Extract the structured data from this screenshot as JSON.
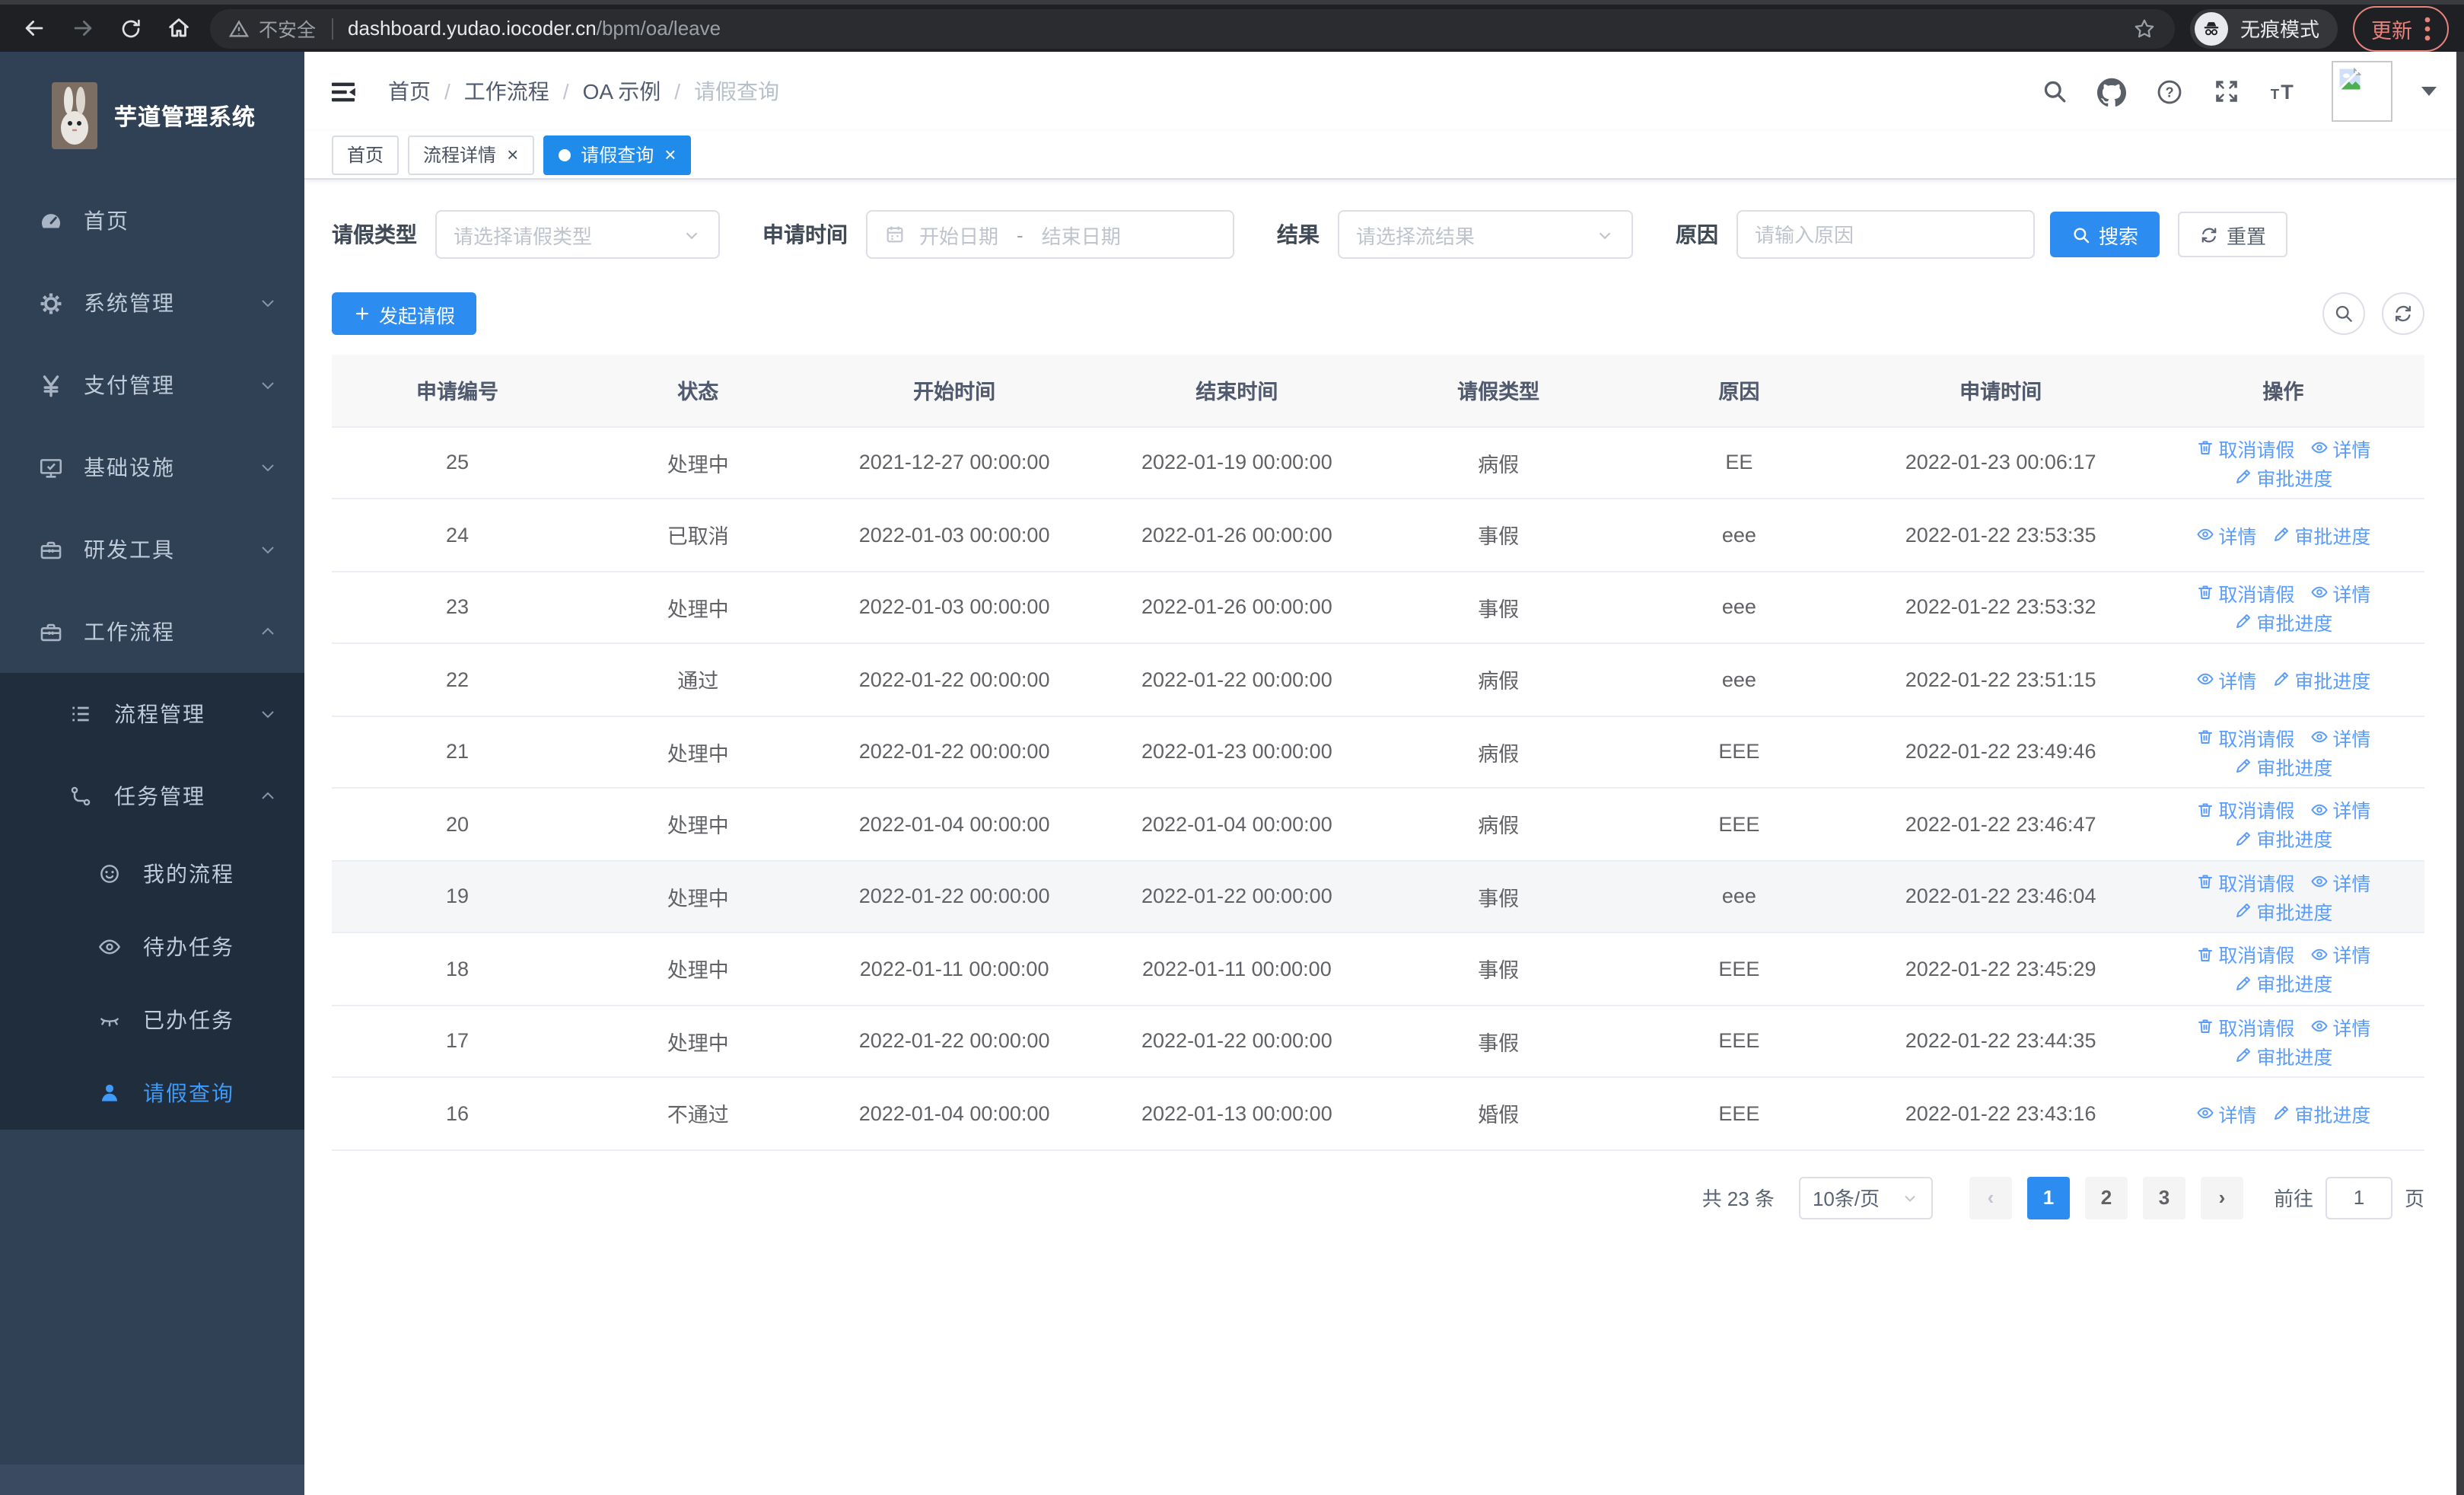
{
  "browser": {
    "security_label": "不安全",
    "url_domain": "dashboard.yudao.iocoder.cn",
    "url_path": "/bpm/oa/leave",
    "incognito_label": "无痕模式",
    "update_label": "更新"
  },
  "sidebar": {
    "app_title": "芋道管理系统",
    "menu": [
      {
        "label": "首页"
      },
      {
        "label": "系统管理"
      },
      {
        "label": "支付管理"
      },
      {
        "label": "基础设施"
      },
      {
        "label": "研发工具"
      },
      {
        "label": "工作流程"
      }
    ],
    "submenu": [
      {
        "label": "流程管理"
      },
      {
        "label": "任务管理"
      }
    ],
    "task_items": [
      {
        "label": "我的流程"
      },
      {
        "label": "待办任务"
      },
      {
        "label": "已办任务"
      },
      {
        "label": "请假查询"
      }
    ]
  },
  "header": {
    "breadcrumb": [
      "首页",
      "工作流程",
      "OA 示例",
      "请假查询"
    ]
  },
  "tabs": [
    {
      "label": "首页"
    },
    {
      "label": "流程详情"
    },
    {
      "label": "请假查询"
    }
  ],
  "filters": {
    "leave_type_label": "请假类型",
    "leave_type_placeholder": "请选择请假类型",
    "apply_time_label": "申请时间",
    "start_date_placeholder": "开始日期",
    "range_separator": "-",
    "end_date_placeholder": "结束日期",
    "result_label": "结果",
    "result_placeholder": "请选择流结果",
    "reason_label": "原因",
    "reason_placeholder": "请输入原因",
    "search_label": "搜索",
    "reset_label": "重置"
  },
  "toolbar": {
    "create_label": "发起请假"
  },
  "table": {
    "columns": [
      "申请编号",
      "状态",
      "开始时间",
      "结束时间",
      "请假类型",
      "原因",
      "申请时间",
      "操作"
    ],
    "action_defs": {
      "cancel": {
        "label": "取消请假",
        "icon": "trash"
      },
      "detail": {
        "label": "详情",
        "icon": "eye"
      },
      "progress": {
        "label": "审批进度",
        "icon": "pen"
      }
    },
    "rows": [
      {
        "id": "25",
        "status": "处理中",
        "start_time": "2021-12-27 00:00:00",
        "end_time": "2022-01-19 00:00:00",
        "leave_type": "病假",
        "reason": "EE",
        "apply_time": "2022-01-23 00:06:17",
        "actions": [
          "cancel",
          "detail",
          "progress"
        ],
        "highlighted": false
      },
      {
        "id": "24",
        "status": "已取消",
        "start_time": "2022-01-03 00:00:00",
        "end_time": "2022-01-26 00:00:00",
        "leave_type": "事假",
        "reason": "eee",
        "apply_time": "2022-01-22 23:53:35",
        "actions": [
          "detail",
          "progress"
        ],
        "highlighted": false
      },
      {
        "id": "23",
        "status": "处理中",
        "start_time": "2022-01-03 00:00:00",
        "end_time": "2022-01-26 00:00:00",
        "leave_type": "事假",
        "reason": "eee",
        "apply_time": "2022-01-22 23:53:32",
        "actions": [
          "cancel",
          "detail",
          "progress"
        ],
        "highlighted": false
      },
      {
        "id": "22",
        "status": "通过",
        "start_time": "2022-01-22 00:00:00",
        "end_time": "2022-01-22 00:00:00",
        "leave_type": "病假",
        "reason": "eee",
        "apply_time": "2022-01-22 23:51:15",
        "actions": [
          "detail",
          "progress"
        ],
        "highlighted": false
      },
      {
        "id": "21",
        "status": "处理中",
        "start_time": "2022-01-22 00:00:00",
        "end_time": "2022-01-23 00:00:00",
        "leave_type": "病假",
        "reason": "EEE",
        "apply_time": "2022-01-22 23:49:46",
        "actions": [
          "cancel",
          "detail",
          "progress"
        ],
        "highlighted": false
      },
      {
        "id": "20",
        "status": "处理中",
        "start_time": "2022-01-04 00:00:00",
        "end_time": "2022-01-04 00:00:00",
        "leave_type": "病假",
        "reason": "EEE",
        "apply_time": "2022-01-22 23:46:47",
        "actions": [
          "cancel",
          "detail",
          "progress"
        ],
        "highlighted": false
      },
      {
        "id": "19",
        "status": "处理中",
        "start_time": "2022-01-22 00:00:00",
        "end_time": "2022-01-22 00:00:00",
        "leave_type": "事假",
        "reason": "eee",
        "apply_time": "2022-01-22 23:46:04",
        "actions": [
          "cancel",
          "detail",
          "progress"
        ],
        "highlighted": true
      },
      {
        "id": "18",
        "status": "处理中",
        "start_time": "2022-01-11 00:00:00",
        "end_time": "2022-01-11 00:00:00",
        "leave_type": "事假",
        "reason": "EEE",
        "apply_time": "2022-01-22 23:45:29",
        "actions": [
          "cancel",
          "detail",
          "progress"
        ],
        "highlighted": false
      },
      {
        "id": "17",
        "status": "处理中",
        "start_time": "2022-01-22 00:00:00",
        "end_time": "2022-01-22 00:00:00",
        "leave_type": "事假",
        "reason": "EEE",
        "apply_time": "2022-01-22 23:44:35",
        "actions": [
          "cancel",
          "detail",
          "progress"
        ],
        "highlighted": false
      },
      {
        "id": "16",
        "status": "不通过",
        "start_time": "2022-01-04 00:00:00",
        "end_time": "2022-01-13 00:00:00",
        "leave_type": "婚假",
        "reason": "EEE",
        "apply_time": "2022-01-22 23:43:16",
        "actions": [
          "detail",
          "progress"
        ],
        "highlighted": false
      }
    ]
  },
  "pagination": {
    "total_label": "共 23 条",
    "page_size_value": "10条/页",
    "prev": "‹",
    "next": "›",
    "pages": [
      "1",
      "2",
      "3"
    ],
    "active_page": "1",
    "goto_label": "前往",
    "goto_value": "1",
    "goto_suffix": "页"
  },
  "colors": {
    "primary": "#2d8cf0",
    "link": "#5a9cf8",
    "sidebar_bg": "#304156",
    "submenu_bg": "#1f2d3d",
    "active_tab": "#1f8ceb",
    "update_accent": "#e8837c"
  }
}
